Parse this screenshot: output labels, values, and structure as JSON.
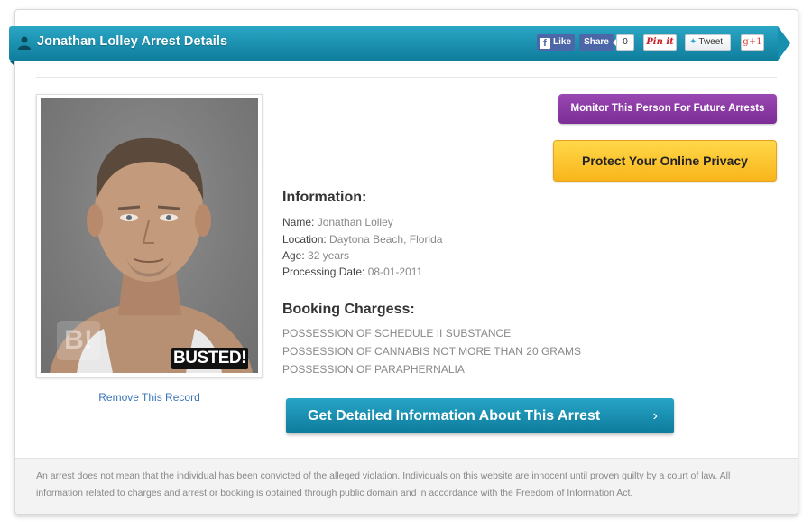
{
  "header": {
    "title": "Jonathan Lolley Arrest Details",
    "social": {
      "like_label": "Like",
      "like_icon": "f",
      "share_label": "Share",
      "share_count": "0",
      "pinit_label": "Pin it",
      "tweet_label": "Tweet",
      "gplus_label": "g+1"
    }
  },
  "photo": {
    "watermark": "B!",
    "stamp": "BUSTED!"
  },
  "remove_link": "Remove This Record",
  "buttons": {
    "monitor": "Monitor This Person For Future Arrests",
    "privacy": "Protect Your Online Privacy",
    "detail": "Get Detailed Information About This Arrest",
    "detail_chevron": "›"
  },
  "information": {
    "title": "Information:",
    "rows": [
      {
        "label": "Name:",
        "value": "Jonathan Lolley"
      },
      {
        "label": "Location:",
        "value": "Daytona Beach, Florida"
      },
      {
        "label": "Age:",
        "value": "32 years"
      },
      {
        "label": "Processing Date:",
        "value": "08-01-2011"
      }
    ]
  },
  "charges": {
    "title": "Booking Chargess:",
    "items": [
      "POSSESSION OF SCHEDULE II SUBSTANCE",
      "POSSESSION OF CANNABIS NOT MORE THAN 20 GRAMS",
      "POSSESSION OF PARAPHERNALIA"
    ]
  },
  "footer": {
    "disclaimer": "An arrest does not mean that the individual has been convicted of the alleged violation. Individuals on this website are innocent until proven guilty by a court of law. All information related to charges and arrest or booking is obtained through public domain and in accordance with the Freedom of Information Act."
  },
  "colors": {
    "ribbon": "#1690ae",
    "monitor_button": "#8a3aa4",
    "privacy_button": "#fcc633",
    "detail_button": "#1a8fb0",
    "link": "#3a74b8"
  }
}
